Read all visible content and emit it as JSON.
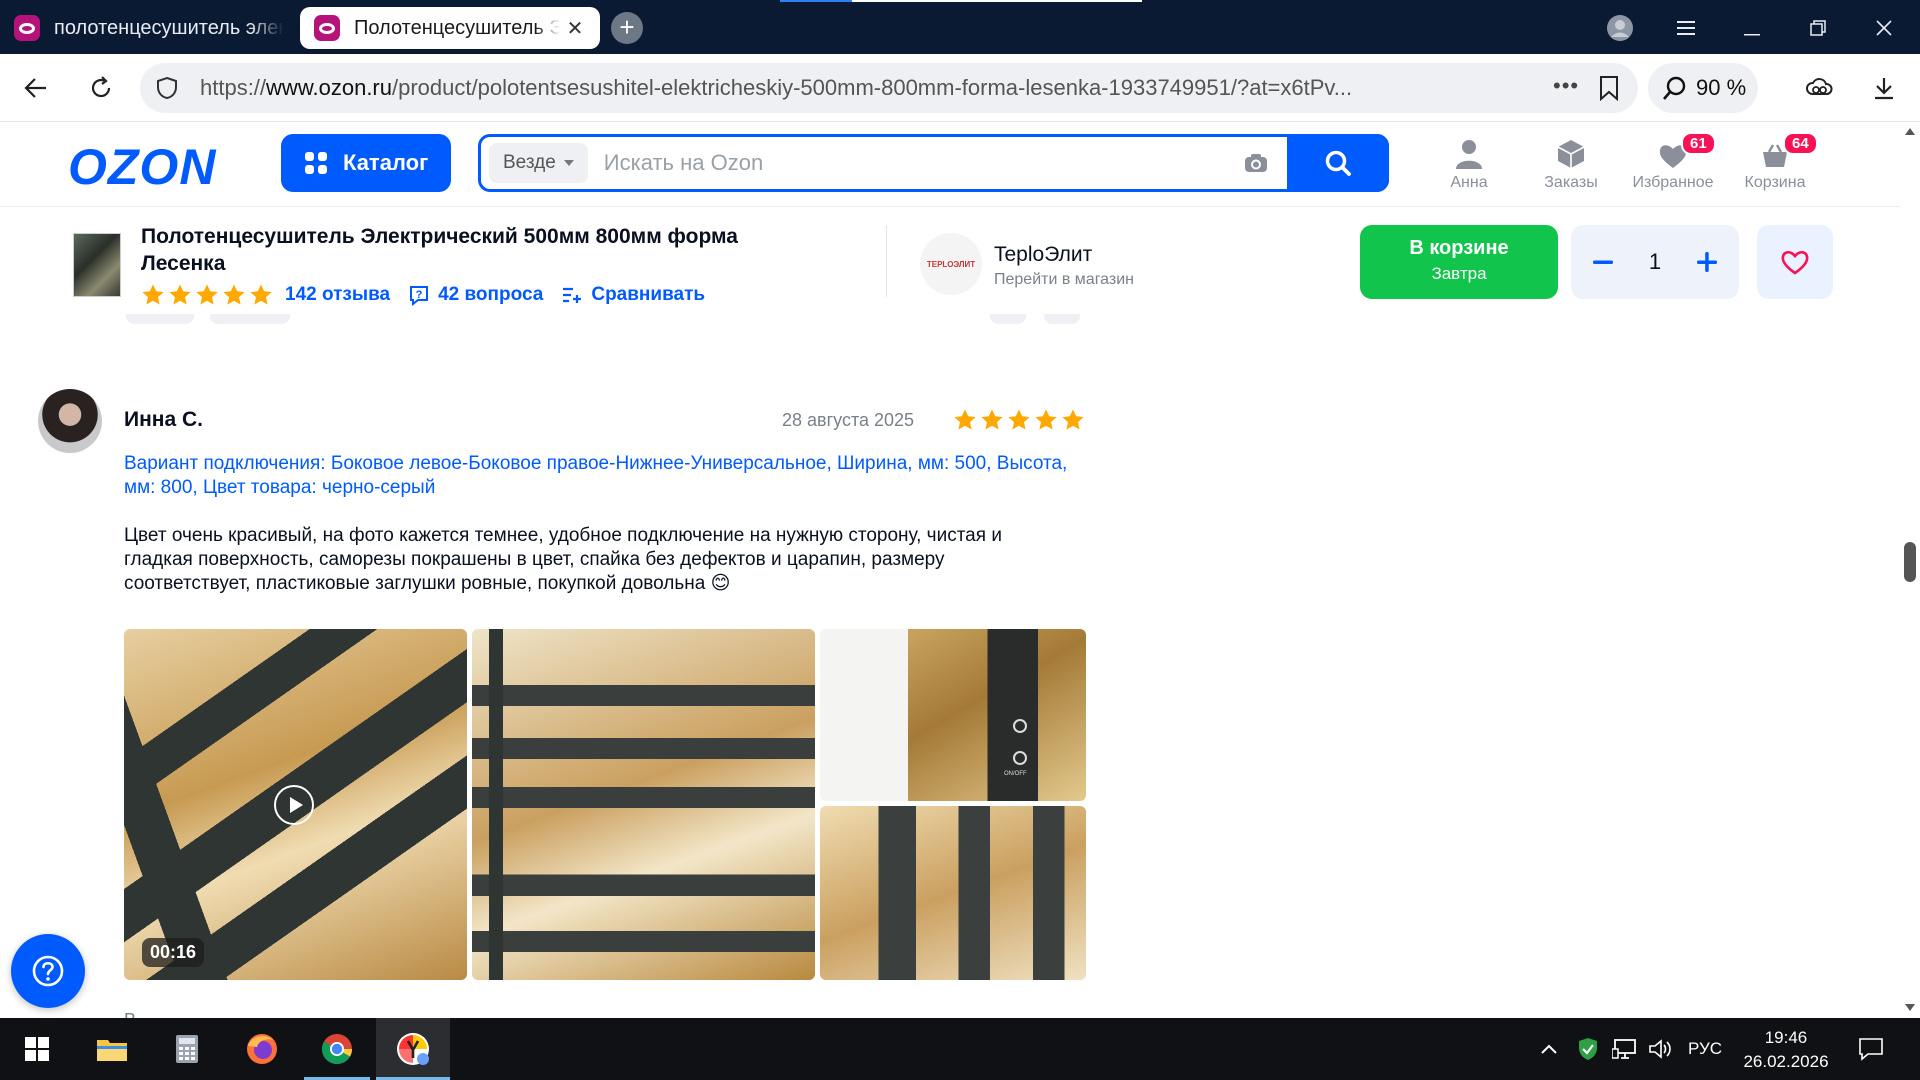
{
  "browser": {
    "tabs": [
      {
        "title": "полотенцесушитель электрический",
        "active": false
      },
      {
        "title": "Полотенцесушитель Электрический",
        "active": true
      }
    ],
    "url_prefix": "https://",
    "url_domain": "www.ozon.ru",
    "url_path": "/product/polotentsesushitel-elektricheskiy-500mm-800mm-forma-lesenka-1933749951/?at=x6tPv...",
    "zoom": "90 %"
  },
  "header": {
    "logo": "OZON",
    "catalog_label": "Каталог",
    "search_scope": "Везде",
    "search_placeholder": "Искать на Ozon",
    "profile_label": "Анна",
    "orders_label": "Заказы",
    "favorites_label": "Избранное",
    "favorites_count": "61",
    "cart_label": "Корзина",
    "cart_count": "64"
  },
  "product_bar": {
    "title": "Полотенцесушитель Электрический 500мм 800мм форма Лесенка",
    "rating_stars": 5,
    "reviews_label": "142 отзыва",
    "questions_label": "42 вопроса",
    "compare_label": "Сравнивать",
    "shop_logo_text": "TEPLOЭЛИТ",
    "shop_name": "TeploЭлит",
    "shop_link": "Перейти в магазин",
    "cart_button_line1": "В корзине",
    "cart_button_line2": "Завтра",
    "quantity": "1"
  },
  "review": {
    "author": "Инна С.",
    "date": "28 августа 2025",
    "rating": 5,
    "variant": "Вариант подключения: Боковое левое-Боковое правое-Нижнее-Универсальное, Ширина, мм: 500, Высота, мм: 800, Цвет товара: черно-серый",
    "text": "Цвет очень красивый, на фото кажется темнее, удобное подключение на нужную сторону, чистая и гладкая поверхность, саморезы покрашены в цвет, спайка без дефектов и царапин, размеру соответствует, пластиковые заглушки ровные, покупкой довольна 😊",
    "video_duration": "00:16",
    "photo_caption": "ON/OFF",
    "next_hint": "В..."
  },
  "colors": {
    "accent": "#005bff",
    "cart_green": "#10c44c",
    "star": "#ffa800",
    "badge": "#f91155"
  },
  "taskbar": {
    "language": "РУС",
    "time": "19:46",
    "date": "26.02.2026"
  }
}
